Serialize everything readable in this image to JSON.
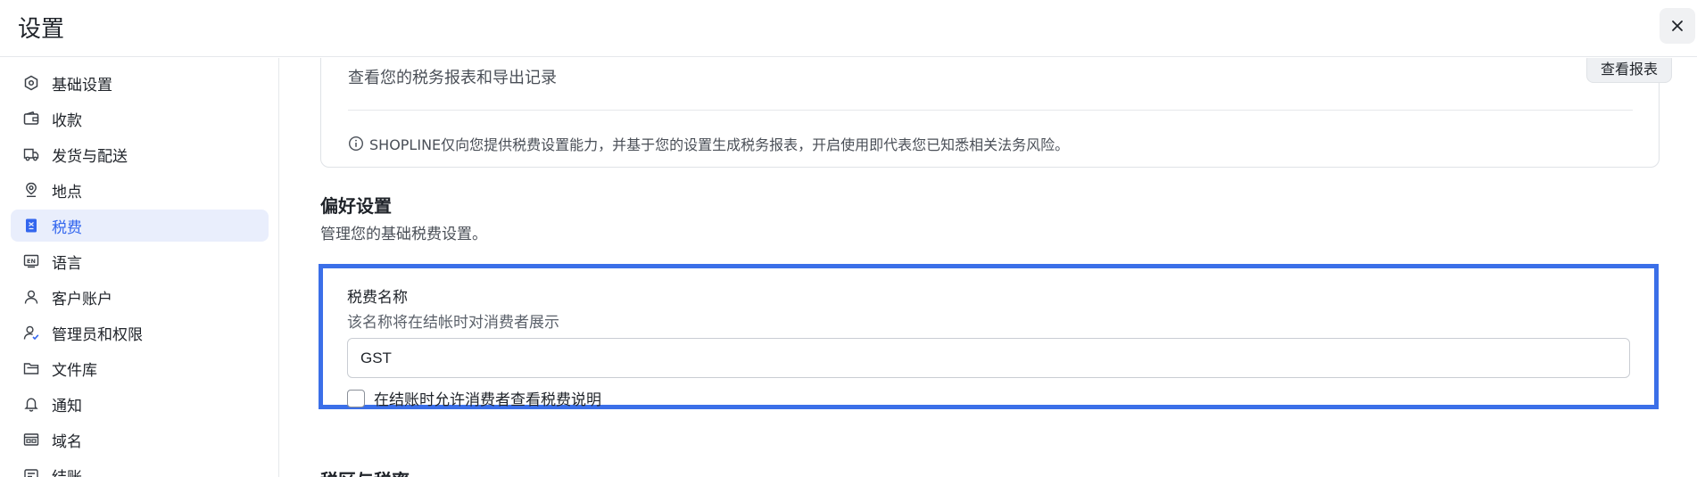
{
  "header": {
    "title": "设置",
    "close_icon": "close-icon"
  },
  "sidebar": {
    "items": [
      {
        "label": "基础设置",
        "icon": "hexagon-settings-icon",
        "active": false
      },
      {
        "label": "收款",
        "icon": "wallet-icon",
        "active": false
      },
      {
        "label": "发货与配送",
        "icon": "truck-icon",
        "active": false
      },
      {
        "label": "地点",
        "icon": "location-pin-icon",
        "active": false
      },
      {
        "label": "税费",
        "icon": "tax-receipt-icon",
        "active": true
      },
      {
        "label": "语言",
        "icon": "language-en-icon",
        "active": false
      },
      {
        "label": "客户账户",
        "icon": "user-icon",
        "active": false
      },
      {
        "label": "管理员和权限",
        "icon": "user-check-icon",
        "active": false
      },
      {
        "label": "文件库",
        "icon": "folder-icon",
        "active": false
      },
      {
        "label": "通知",
        "icon": "bell-icon",
        "active": false
      },
      {
        "label": "域名",
        "icon": "domain-icon",
        "active": false
      },
      {
        "label": "结账",
        "icon": "checkout-icon",
        "active": false
      }
    ]
  },
  "report": {
    "description": "查看您的税务报表和导出记录",
    "button_label": "查看报表",
    "notice": "SHOPLINE仅向您提供税费设置能力，并基于您的设置生成税务报表，开启使用即代表您已知悉相关法务风险。"
  },
  "preferences": {
    "title": "偏好设置",
    "description": "管理您的基础税费设置。"
  },
  "tax_name": {
    "label": "税费名称",
    "help": "该名称将在结帐时对消费者展示",
    "value": "GST",
    "checkbox_label": "在结账时允许消费者查看税费说明",
    "checkbox_checked": false
  },
  "regions": {
    "title": "税区与税率"
  },
  "colors": {
    "accent": "#3366ee",
    "highlight_border": "#3b6fe8",
    "active_bg": "#e9eefc"
  }
}
